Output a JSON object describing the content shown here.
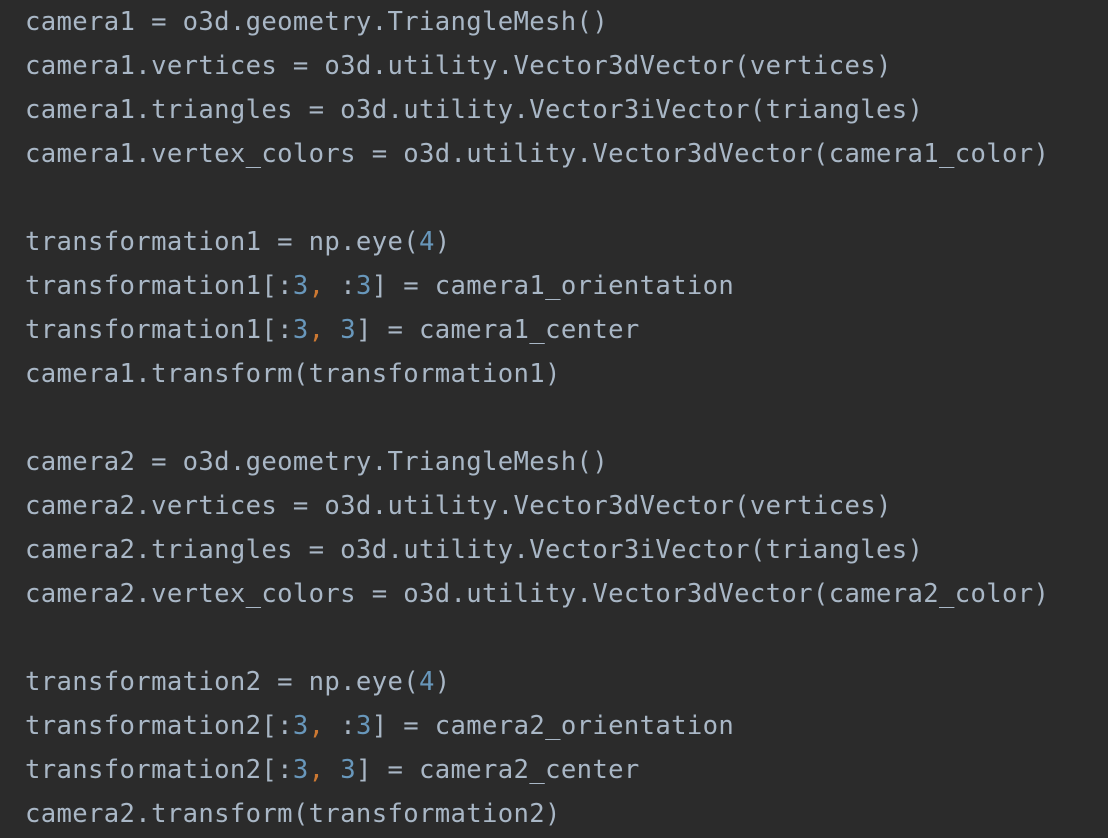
{
  "colors": {
    "background": "#2b2b2b",
    "default": "#a9b7c6",
    "number": "#6897bb",
    "comma": "#cc7832"
  },
  "lines": [
    [
      [
        "camera1 = o3d.geometry.TriangleMesh()",
        "default"
      ]
    ],
    [
      [
        "camera1.vertices = o3d.utility.Vector3dVector(vertices)",
        "default"
      ]
    ],
    [
      [
        "camera1.triangles = o3d.utility.Vector3iVector(triangles)",
        "default"
      ]
    ],
    [
      [
        "camera1.vertex_colors = o3d.utility.Vector3dVector(camera1_color)",
        "default"
      ]
    ],
    [],
    [
      [
        "transformation1 = np.eye(",
        "default"
      ],
      [
        "4",
        "number"
      ],
      [
        ")",
        "default"
      ]
    ],
    [
      [
        "transformation1[:",
        "default"
      ],
      [
        "3",
        "number"
      ],
      [
        ",",
        "comma"
      ],
      [
        " :",
        "default"
      ],
      [
        "3",
        "number"
      ],
      [
        "] = camera1_orientation",
        "default"
      ]
    ],
    [
      [
        "transformation1[:",
        "default"
      ],
      [
        "3",
        "number"
      ],
      [
        ",",
        "comma"
      ],
      [
        " ",
        "default"
      ],
      [
        "3",
        "number"
      ],
      [
        "] = camera1_center",
        "default"
      ]
    ],
    [
      [
        "camera1.transform(transformation1)",
        "default"
      ]
    ],
    [],
    [
      [
        "camera2 = o3d.geometry.TriangleMesh()",
        "default"
      ]
    ],
    [
      [
        "camera2.vertices = o3d.utility.Vector3dVector(vertices)",
        "default"
      ]
    ],
    [
      [
        "camera2.triangles = o3d.utility.Vector3iVector(triangles)",
        "default"
      ]
    ],
    [
      [
        "camera2.vertex_colors = o3d.utility.Vector3dVector(camera2_color)",
        "default"
      ]
    ],
    [],
    [
      [
        "transformation2 = np.eye(",
        "default"
      ],
      [
        "4",
        "number"
      ],
      [
        ")",
        "default"
      ]
    ],
    [
      [
        "transformation2[:",
        "default"
      ],
      [
        "3",
        "number"
      ],
      [
        ",",
        "comma"
      ],
      [
        " :",
        "default"
      ],
      [
        "3",
        "number"
      ],
      [
        "] = camera2_orientation",
        "default"
      ]
    ],
    [
      [
        "transformation2[:",
        "default"
      ],
      [
        "3",
        "number"
      ],
      [
        ",",
        "comma"
      ],
      [
        " ",
        "default"
      ],
      [
        "3",
        "number"
      ],
      [
        "] = camera2_center",
        "default"
      ]
    ],
    [
      [
        "camera2.transform(transformation2)",
        "default"
      ]
    ]
  ]
}
